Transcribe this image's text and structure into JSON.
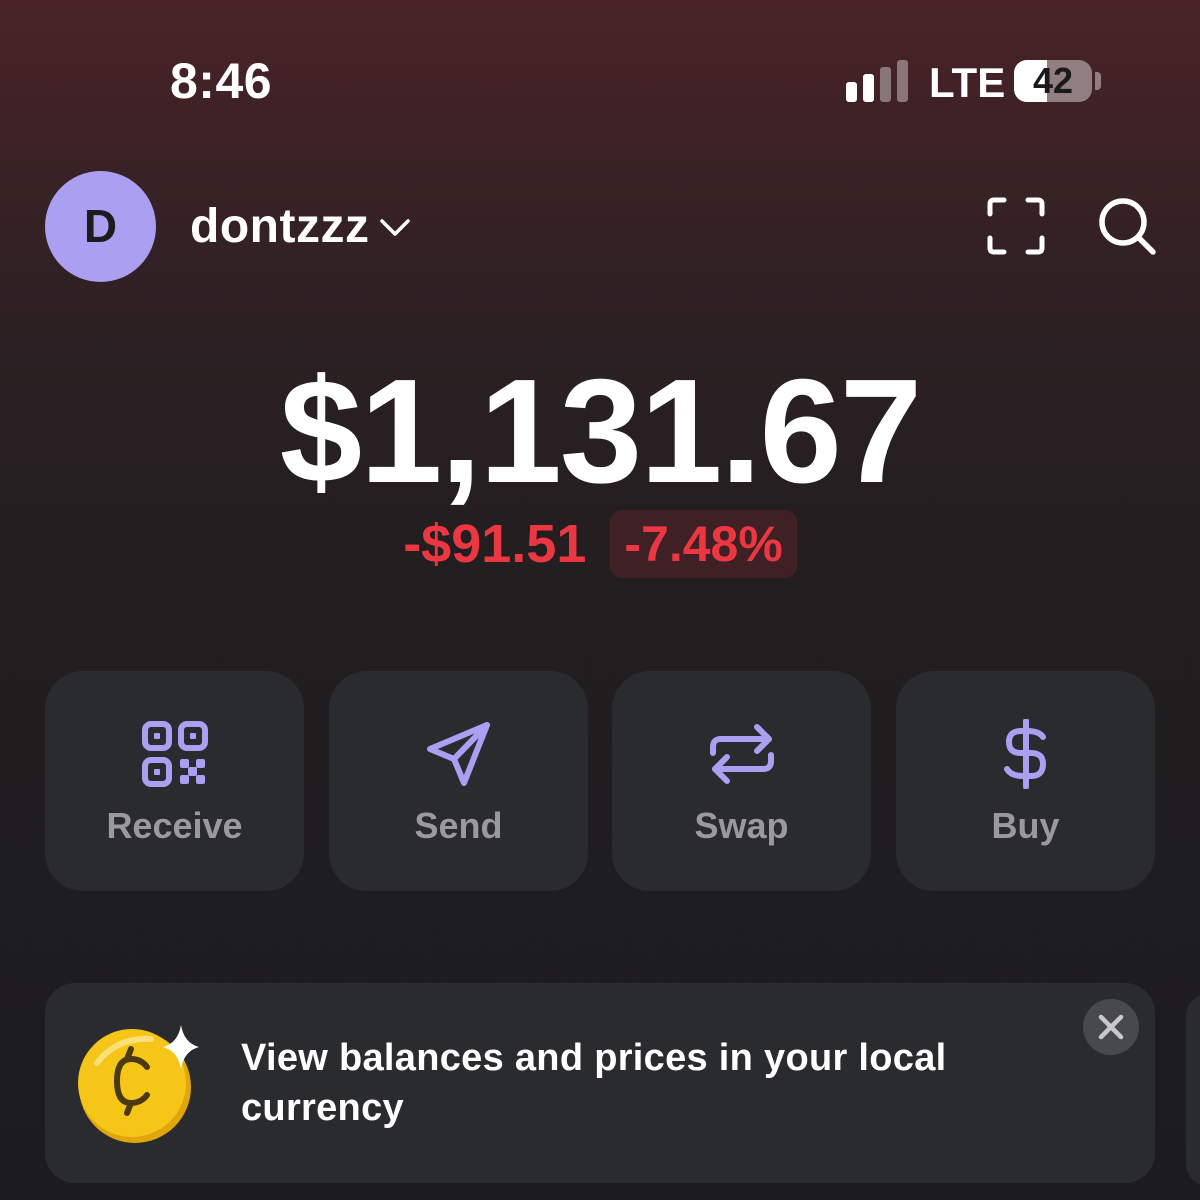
{
  "status_bar": {
    "time": "8:46",
    "network": "LTE",
    "battery_level": "42",
    "battery_fraction": 0.42
  },
  "header": {
    "avatar_initial": "D",
    "account_name": "dontzzz",
    "icons": [
      "chevron-down-icon",
      "scan-icon",
      "search-icon"
    ]
  },
  "balance": {
    "total": "$1,131.67",
    "change_amount": "-$91.51",
    "change_percent": "-7.48%"
  },
  "actions": [
    {
      "label": "Receive",
      "icon": "qr-code-icon"
    },
    {
      "label": "Send",
      "icon": "send-icon"
    },
    {
      "label": "Swap",
      "icon": "swap-icon"
    },
    {
      "label": "Buy",
      "icon": "dollar-icon"
    }
  ],
  "promo": {
    "text": "View balances and prices in your local currency",
    "icon": "coin-sparkle-icon"
  },
  "colors": {
    "accent": "#ab9ff2",
    "negative": "#eb3742",
    "card": "#2a2b2f",
    "label_gray": "#9a9a9e",
    "coin": "#f5c518"
  }
}
